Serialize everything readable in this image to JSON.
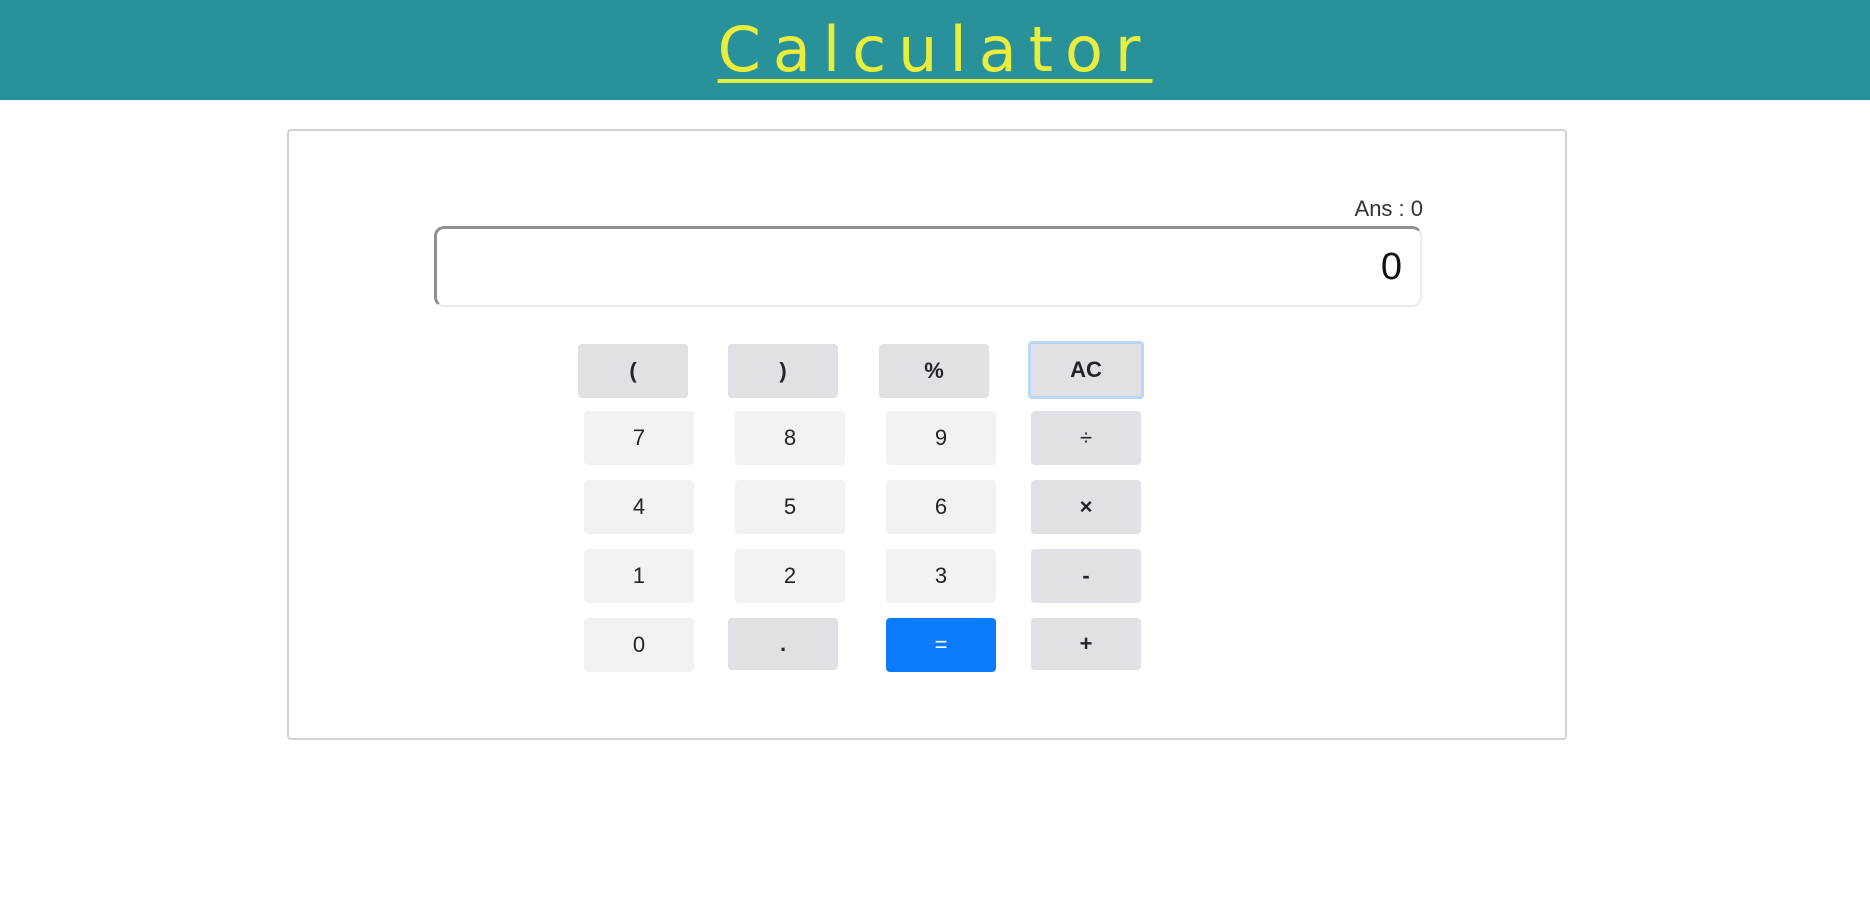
{
  "header": {
    "title": "Calculator"
  },
  "calculator": {
    "ans_label": "Ans : 0",
    "display_value": "0",
    "top_row": {
      "open_paren": "(",
      "close_paren": ")",
      "percent": "%",
      "clear": "AC"
    },
    "keys": {
      "seven": "7",
      "eight": "8",
      "nine": "9",
      "divide": "÷",
      "four": "4",
      "five": "5",
      "six": "6",
      "multiply": "×",
      "one": "1",
      "two": "2",
      "three": "3",
      "minus": "-",
      "zero": "0",
      "dot": ".",
      "equals": "=",
      "plus": "+"
    }
  },
  "colors": {
    "header_bg": "#289199",
    "title": "#e9ee3c",
    "equals_bg": "#0b7bfd"
  }
}
